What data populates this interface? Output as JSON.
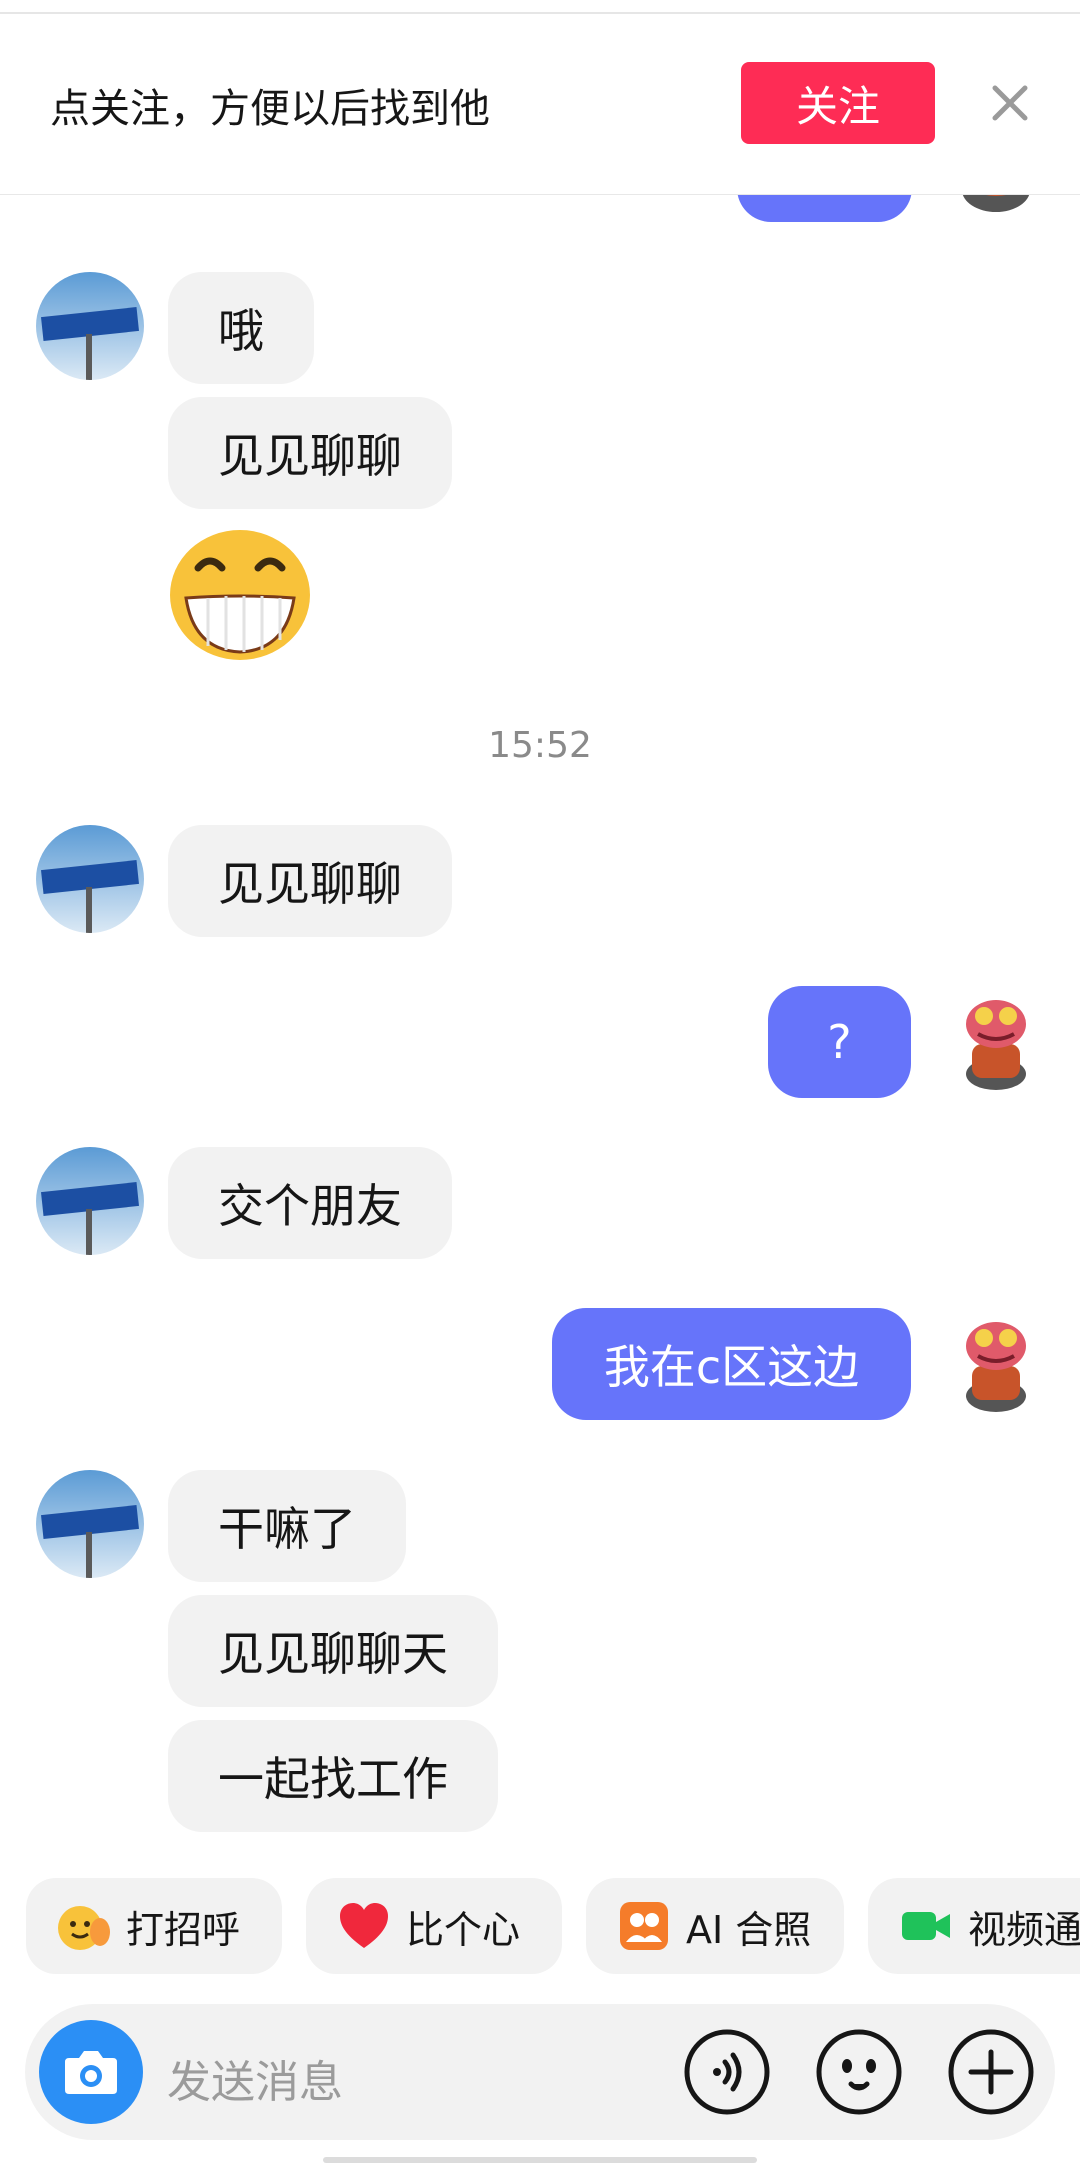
{
  "follow_bar": {
    "prompt": "点关注，方便以后找到他",
    "follow_label": "关注"
  },
  "messages": [
    {
      "side": "in",
      "text": "哦"
    },
    {
      "side": "in",
      "text": "见见聊聊"
    },
    {
      "side": "in",
      "sticker": "grinning-emoji"
    },
    {
      "timestamp": "15:52"
    },
    {
      "side": "in",
      "text": "见见聊聊"
    },
    {
      "side": "out",
      "text": "?"
    },
    {
      "side": "in",
      "text": "交个朋友"
    },
    {
      "side": "out",
      "text": "我在c区这边"
    },
    {
      "side": "in",
      "text": "干嘛了"
    },
    {
      "side": "in",
      "text": "见见聊聊天"
    },
    {
      "side": "in",
      "text": "一起找工作"
    }
  ],
  "quick_actions": [
    {
      "label": "打招呼",
      "icon": "wave-icon"
    },
    {
      "label": "比个心",
      "icon": "heart-icon"
    },
    {
      "label": "AI 合照",
      "icon": "ai-photo-icon"
    },
    {
      "label": "视频通",
      "icon": "video-icon"
    }
  ],
  "input": {
    "placeholder": "发送消息"
  },
  "colors": {
    "follow": "#fe2c55",
    "outgoing_bubble": "#6674fa",
    "incoming_bubble": "#f2f2f2",
    "camera": "#2b8ff5"
  }
}
